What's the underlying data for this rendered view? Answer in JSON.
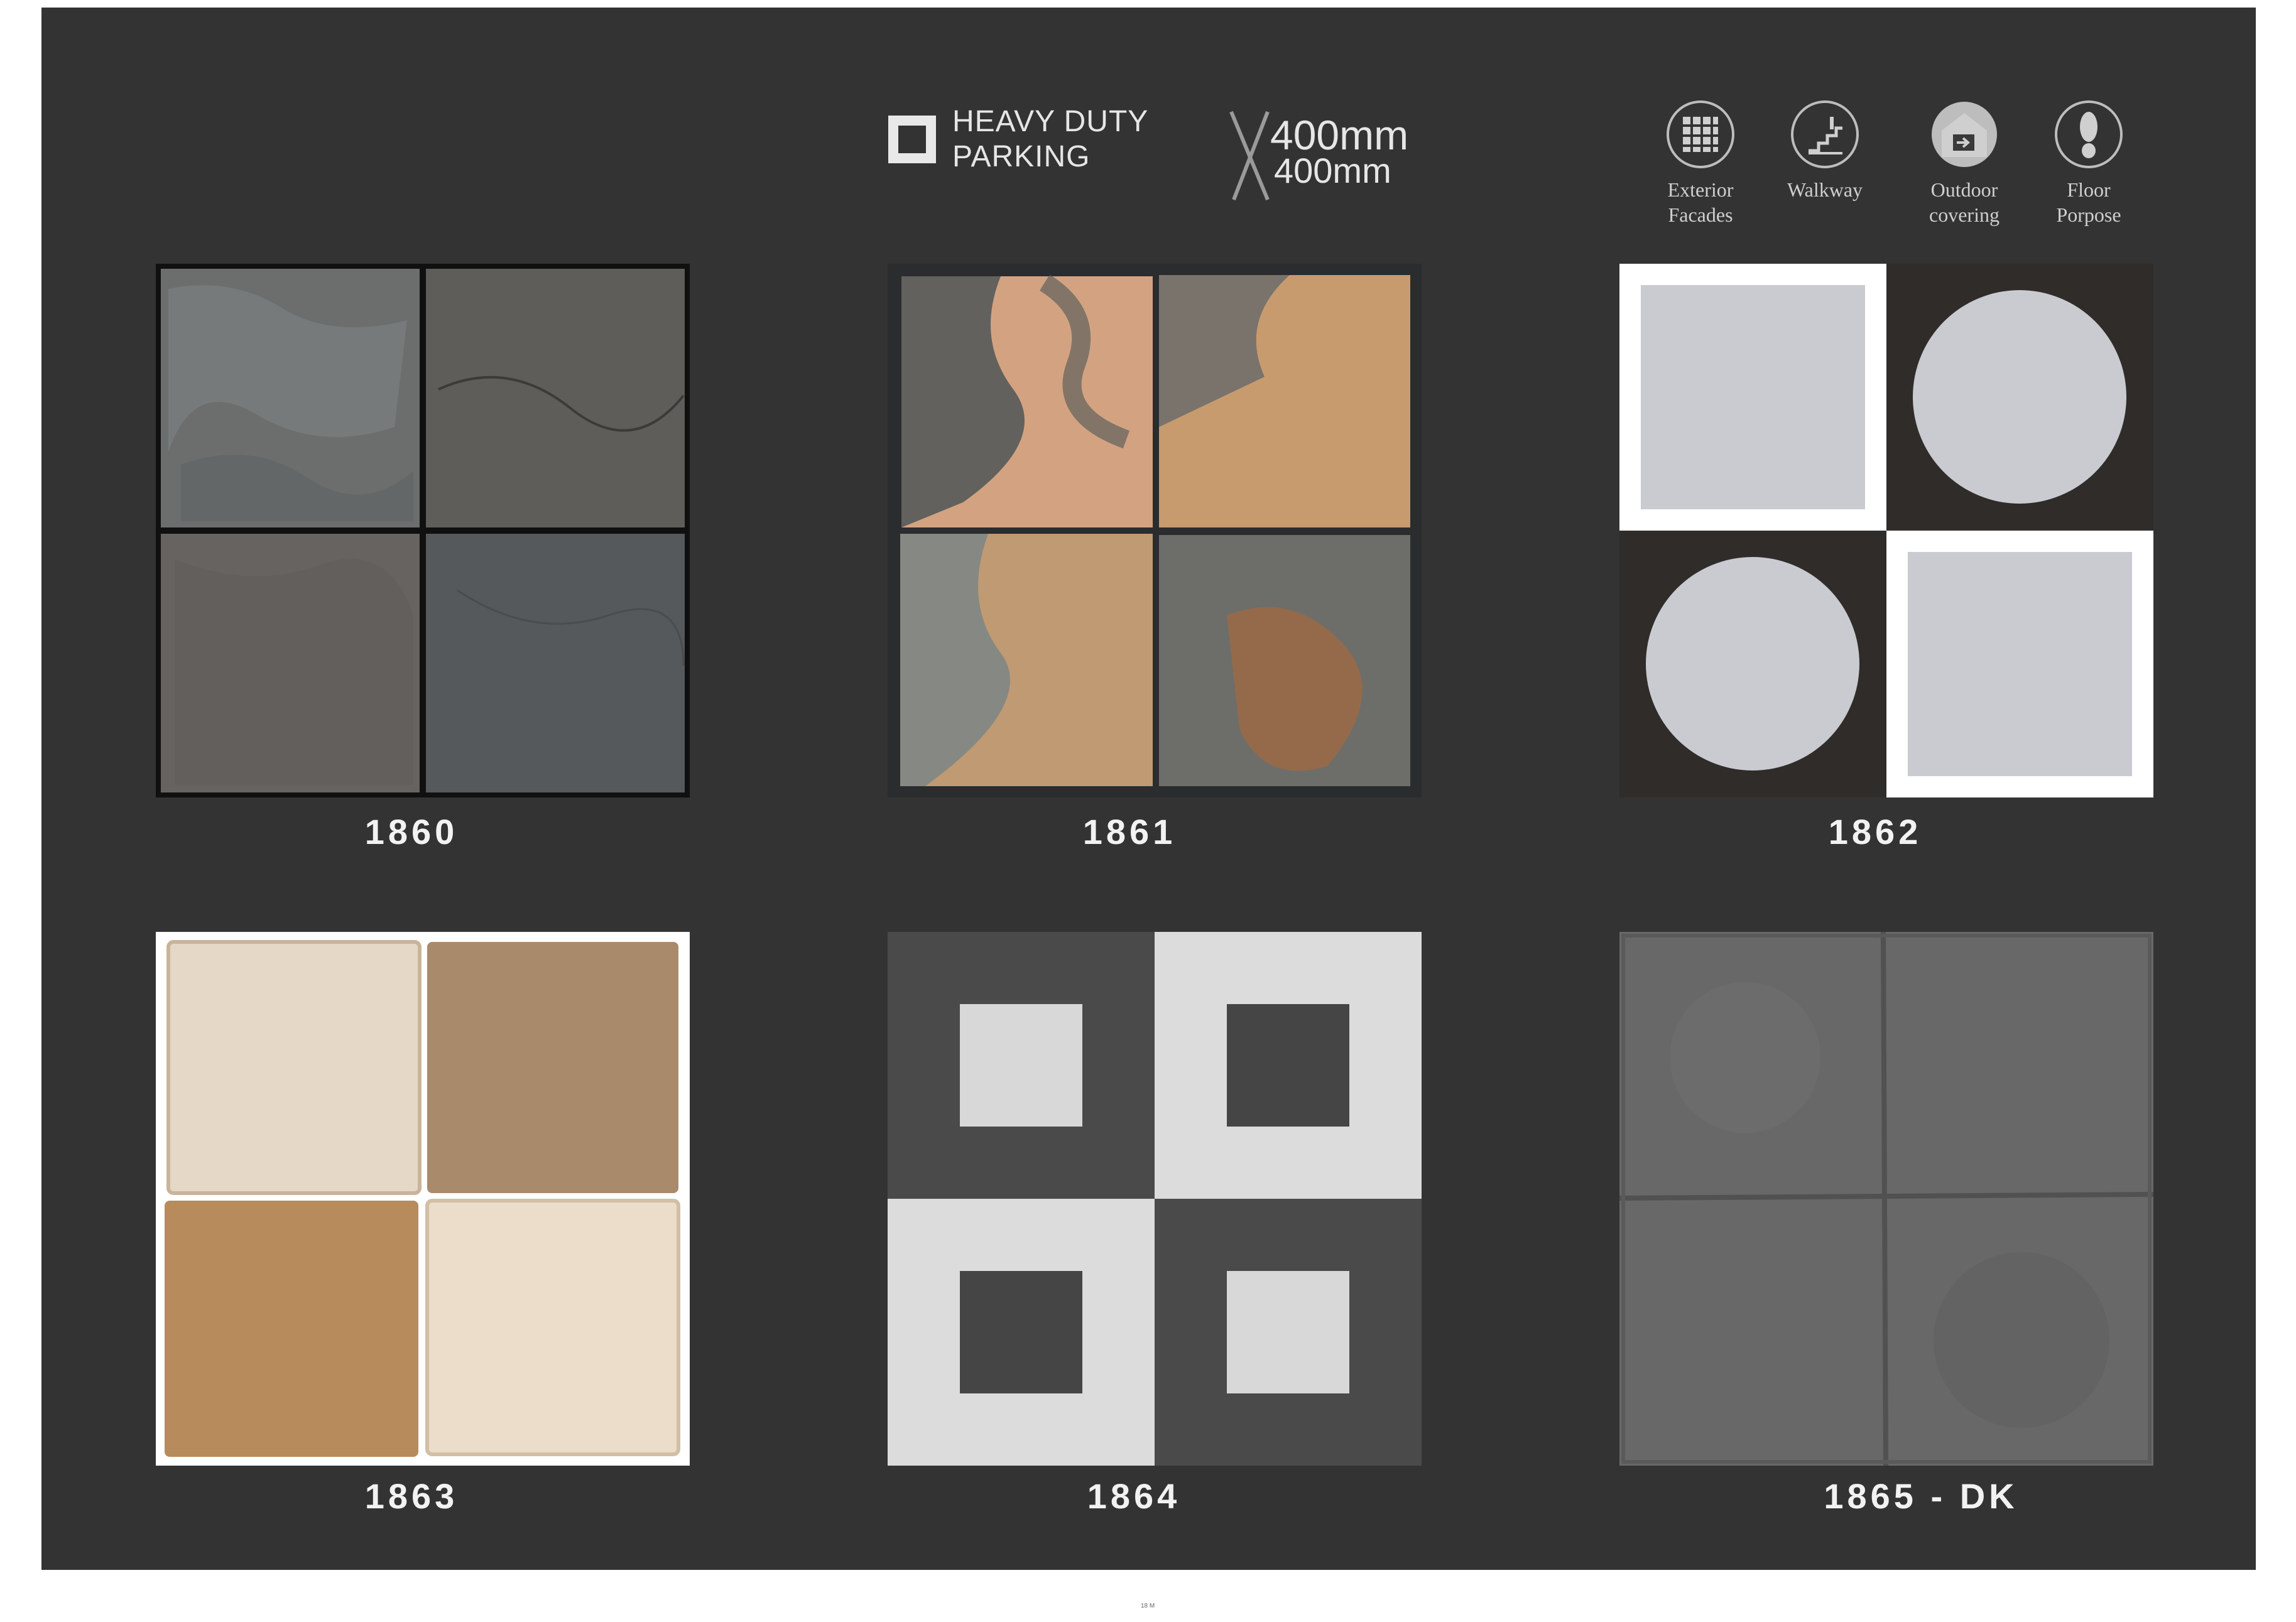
{
  "header": {
    "category_line1": "HEAVY DUTY",
    "category_line2": "PARKING",
    "size_line1": "400mm",
    "size_line2": "400mm"
  },
  "usages": [
    {
      "icon": "grid-icon",
      "line1": "Exterior",
      "line2": "Facades"
    },
    {
      "icon": "stairs-icon",
      "line1": "Walkway",
      "line2": ""
    },
    {
      "icon": "house-icon",
      "line1": "Outdoor",
      "line2": "covering"
    },
    {
      "icon": "footprint-icon",
      "line1": "Floor",
      "line2": "Porpose"
    }
  ],
  "tiles": [
    {
      "code": "1860"
    },
    {
      "code": "1861"
    },
    {
      "code": "1862"
    },
    {
      "code": "1863"
    },
    {
      "code": "1864"
    },
    {
      "code": "1865 - DK"
    }
  ],
  "footer": {
    "page_number": "18 M"
  },
  "colors": {
    "background": "#333333",
    "text": "#e6e6e6"
  }
}
